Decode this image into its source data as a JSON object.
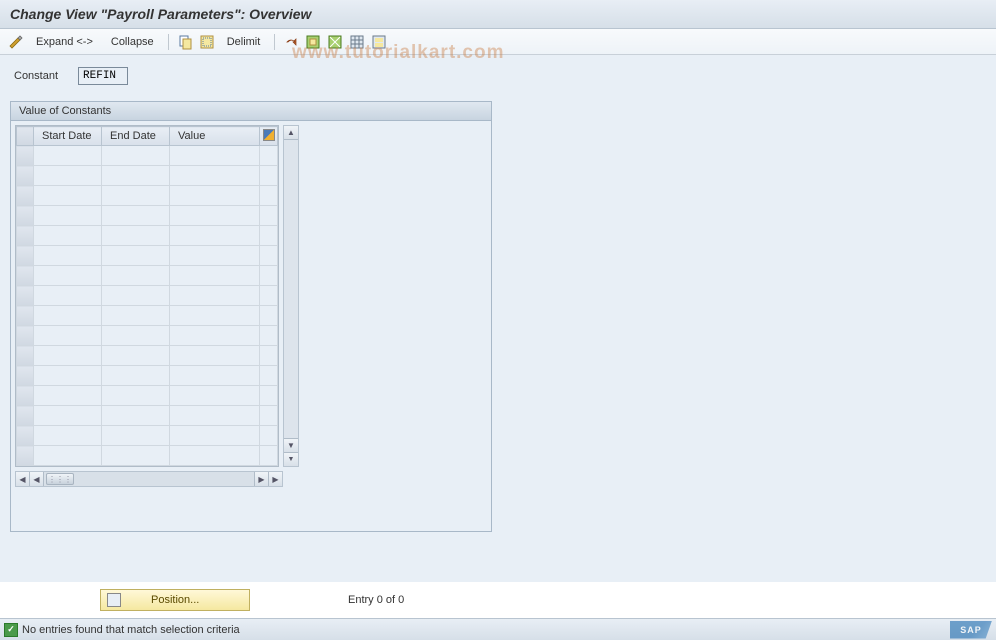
{
  "title": "Change View \"Payroll Parameters\": Overview",
  "toolbar": {
    "expand_label": "Expand <->",
    "collapse_label": "Collapse",
    "delimit_label": "Delimit"
  },
  "constant": {
    "label": "Constant",
    "value": "REFIN"
  },
  "panel": {
    "title": "Value of Constants",
    "columns": {
      "start_date": "Start Date",
      "end_date": "End Date",
      "value": "Value"
    },
    "rows": [
      {
        "start_date": "",
        "end_date": "",
        "value": ""
      },
      {
        "start_date": "",
        "end_date": "",
        "value": ""
      },
      {
        "start_date": "",
        "end_date": "",
        "value": ""
      },
      {
        "start_date": "",
        "end_date": "",
        "value": ""
      },
      {
        "start_date": "",
        "end_date": "",
        "value": ""
      },
      {
        "start_date": "",
        "end_date": "",
        "value": ""
      },
      {
        "start_date": "",
        "end_date": "",
        "value": ""
      },
      {
        "start_date": "",
        "end_date": "",
        "value": ""
      },
      {
        "start_date": "",
        "end_date": "",
        "value": ""
      },
      {
        "start_date": "",
        "end_date": "",
        "value": ""
      },
      {
        "start_date": "",
        "end_date": "",
        "value": ""
      },
      {
        "start_date": "",
        "end_date": "",
        "value": ""
      },
      {
        "start_date": "",
        "end_date": "",
        "value": ""
      },
      {
        "start_date": "",
        "end_date": "",
        "value": ""
      },
      {
        "start_date": "",
        "end_date": "",
        "value": ""
      },
      {
        "start_date": "",
        "end_date": "",
        "value": ""
      }
    ]
  },
  "footer": {
    "position_label": "Position...",
    "entry_text": "Entry 0 of 0"
  },
  "status": {
    "message": "No entries found that match selection criteria"
  },
  "watermark": "www.tutorialkart.com",
  "sap": "SAP"
}
